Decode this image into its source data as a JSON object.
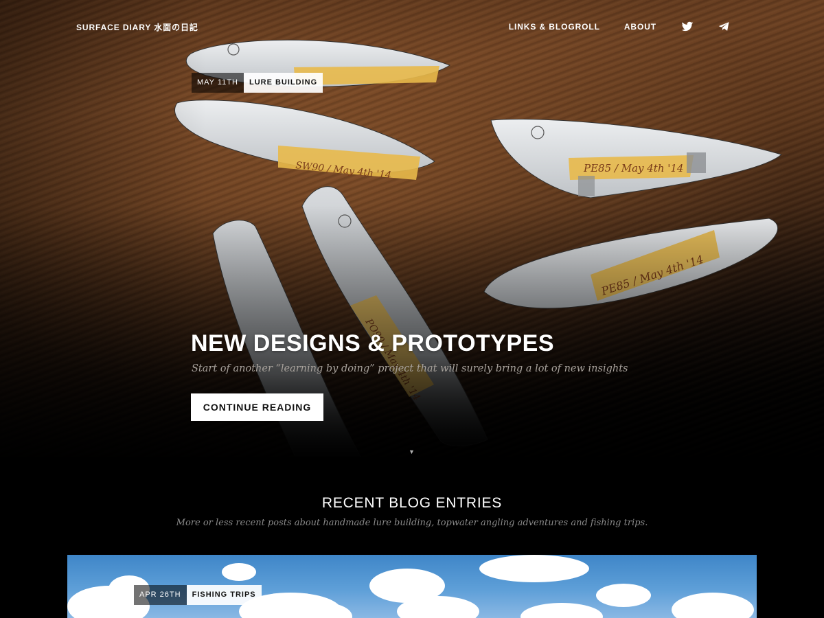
{
  "header": {
    "brand": "SURFACE DIARY 水面の日記",
    "nav": [
      {
        "label": "LINKS & BLOGROLL"
      },
      {
        "label": "ABOUT"
      }
    ],
    "icons": [
      "twitter-icon",
      "telegram-icon"
    ]
  },
  "hero": {
    "date": "MAY 11TH",
    "category": "LURE BUILDING",
    "title": "NEW DESIGNS & PROTOTYPES",
    "subtitle": "Start of another “learning by doing” project that will surely bring a lot of new insights",
    "cta": "CONTINUE READING",
    "scroll_indicator": "▼",
    "lure_labels": [
      "SW90 / May 4th '14",
      "PE85 / May 4th '14",
      "PE85 / May 4th '14",
      "PO90 / May 4th '14"
    ]
  },
  "recent": {
    "title": "RECENT BLOG ENTRIES",
    "subtitle": "More or less recent posts about handmade lure building, topwater angling adventures and fishing trips.",
    "first_post": {
      "date": "APR 26TH",
      "category": "FISHING TRIPS"
    }
  },
  "colors": {
    "background": "#000000",
    "text": "#ffffff",
    "muted": "#8a8a8a",
    "tape": "#e8b94a",
    "sky": "#5e9fd8"
  }
}
